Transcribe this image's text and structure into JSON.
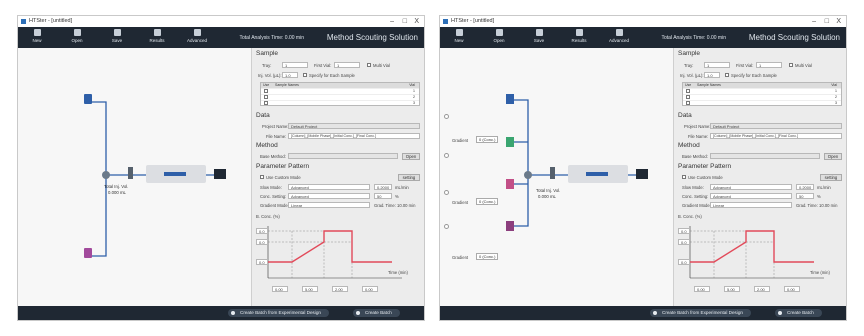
{
  "window": {
    "title": "HTSter - [untitled]",
    "controls": {
      "minimize": "–",
      "maximize": "□",
      "close": "X"
    }
  },
  "toolbar": {
    "buttons": [
      {
        "label": "New",
        "icon": "new-icon"
      },
      {
        "label": "Open",
        "icon": "open-folder-icon"
      },
      {
        "label": "Save",
        "icon": "save-icon"
      },
      {
        "label": "Results",
        "icon": "results-icon"
      },
      {
        "label": "Advanced",
        "icon": "advanced-icon"
      }
    ],
    "total_time": "Total Analysis Time: 0.00 min",
    "mode_title": "Method Scouting Solution"
  },
  "flow": {
    "system_inj_vol": "Total Inj. Vol.",
    "system_inj_val": "0.000 mL",
    "gradient_label": "Gradient",
    "gradient_option": "0 (Conc.)"
  },
  "sample": {
    "title": "Sample",
    "tray_label": "Tray:",
    "tray_value": "1",
    "first_vial_label": "First Vial:",
    "first_vial_value": "1",
    "multi_vial_label": "Multi Vial",
    "inj_vol_label": "Inj. Vol. (µL):",
    "inj_vol_value": "1.0",
    "specify_label": "Specify for Each Sample",
    "table_headers": [
      "Use",
      "Sample Names",
      "Vial"
    ],
    "table_rows": [
      "1",
      "2",
      "3"
    ]
  },
  "data": {
    "title": "Data",
    "project_label": "Project Name:",
    "project_value": "Default Project",
    "file_label": "File Name:",
    "file_value": "[Column]_[Mobile Phase]_[Initial Conc.]_[Final Conc.]"
  },
  "method": {
    "title": "Method",
    "base_label": "Base Method:",
    "open_button": "Open"
  },
  "param": {
    "title": "Parameter Pattern",
    "custom_mode_label": "Use Custom Mode",
    "setting_button": "setting",
    "rows": [
      {
        "label": "Slow Mode:",
        "value": "Advanced",
        "num": "0.2000",
        "unit": "mL/min"
      },
      {
        "label": "Conc. Setting:",
        "value": "Advanced",
        "num": "50",
        "unit": "%"
      },
      {
        "label": "Gradient Mode:",
        "value": "Linear",
        "note": "Grad. Time: 10.00 min"
      }
    ],
    "conc_axis": "B. Conc. (%)",
    "time_axis": "Time (min)",
    "y_ticks": [
      "0.0",
      "0.0",
      "0.0"
    ],
    "x_ticks": [
      "0.00",
      "5.00",
      "2.00",
      "0.00"
    ]
  },
  "status": {
    "create_design": "Create Batch from Experimental Design",
    "create_batch": "Create Batch"
  }
}
